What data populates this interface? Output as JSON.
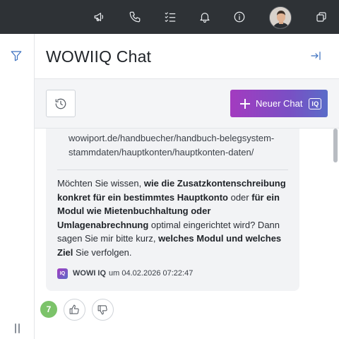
{
  "topbar": {
    "icons": [
      "megaphone-icon",
      "phone-icon",
      "checklist-icon",
      "bell-icon",
      "info-icon",
      "windows-icon"
    ],
    "background": "#2e3236"
  },
  "header": {
    "title": "WOWIIQ Chat"
  },
  "toolbar": {
    "new_chat_label": "Neuer Chat",
    "iq_badge": "IQ",
    "accent_from": "#a33bc0",
    "accent_to": "#5a6cc8"
  },
  "message": {
    "link_line_1": "wowiport.de/handbuecher/handbuch-belegsystem-",
    "link_line_2": "stammdaten/hauptkonten/hauptkonten-daten/",
    "body_parts": [
      {
        "text": "Möchten Sie wissen, ",
        "bold": false
      },
      {
        "text": "wie die Zusatzkontenschreibung konkret für ein bestimmtes Hauptkonto",
        "bold": true
      },
      {
        "text": " oder ",
        "bold": false
      },
      {
        "text": "für ein Modul wie Mietenbuchhaltung oder Umlagenabrechnung",
        "bold": true
      },
      {
        "text": " optimal eingerichtet wird? Dann sagen Sie mir bitte kurz, ",
        "bold": false
      },
      {
        "text": "welches Modul und welches Ziel",
        "bold": true
      },
      {
        "text": " Sie verfolgen.",
        "bold": false
      }
    ],
    "sender_logo": "IQ",
    "sender_name": "WOWI IQ",
    "timestamp": "um 04.02.2026 07:22:47"
  },
  "feedback": {
    "count": "7",
    "badge_color": "#7cc36a"
  }
}
